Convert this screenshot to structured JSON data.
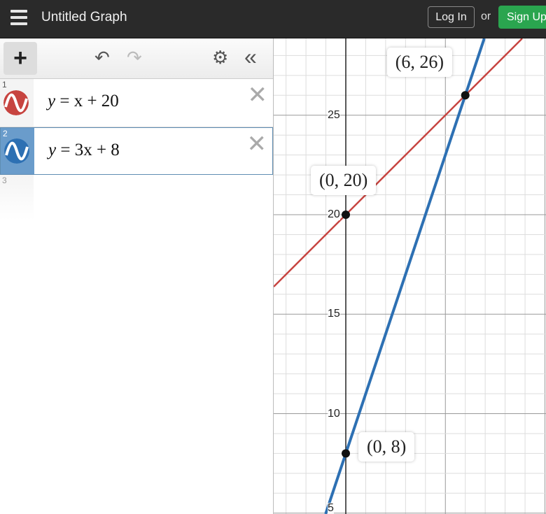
{
  "header": {
    "title": "Untitled Graph",
    "login": "Log In",
    "or": "or",
    "signup": "Sign Up"
  },
  "toolbar": {
    "add": "+",
    "undo": "↶",
    "redo": "↷",
    "settings": "⚙",
    "collapse": "«"
  },
  "expressions": [
    {
      "num": "1",
      "lhs": "y",
      "rhs": "= x + 20",
      "color": "#c74440"
    },
    {
      "num": "2",
      "lhs": "y",
      "rhs": "= 3x + 8",
      "color": "#2d70b3"
    },
    {
      "num": "3"
    }
  ],
  "graph": {
    "y_ticks": [
      "5",
      "10",
      "15",
      "20",
      "25"
    ],
    "points": [
      {
        "label": "(0, 20)",
        "x": 0,
        "y": 20
      },
      {
        "label": "(0, 8)",
        "x": 0,
        "y": 8
      },
      {
        "label": "(6, 26)",
        "x": 6,
        "y": 26
      }
    ],
    "lines": [
      {
        "m": 1,
        "b": 20,
        "color": "#c74440"
      },
      {
        "m": 3,
        "b": 8,
        "color": "#2d70b3"
      }
    ]
  }
}
